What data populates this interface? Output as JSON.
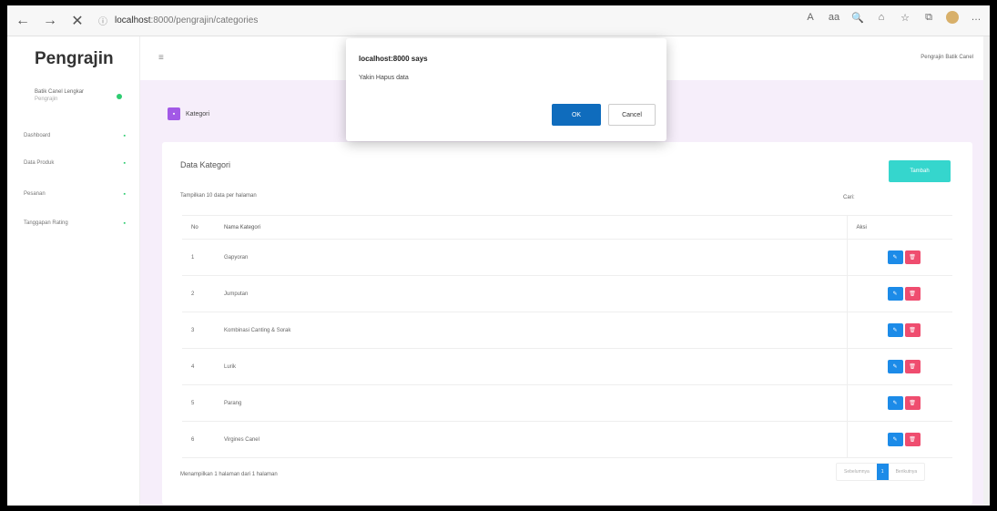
{
  "browser": {
    "url_host": "localhost",
    "url_path": ":8000/pengrajin/categories",
    "back_icon": "←",
    "forward_icon": "→",
    "close_icon": "✕",
    "info_icon": "ⓘ",
    "icons": [
      "A",
      "аа",
      "🔍",
      "⌂",
      "☆",
      "⧉",
      "●",
      "…"
    ]
  },
  "sidebar": {
    "brand": "Pengrajin",
    "user_name": "Batik Canel Lengkar",
    "user_sub": "Pengrajin",
    "items": [
      {
        "label": "Dashboard",
        "icon": "▪"
      },
      {
        "label": "Data Produk",
        "icon": "▪"
      },
      {
        "label": "Pesanan",
        "icon": "▪"
      },
      {
        "label": "Tanggapan Rating",
        "icon": "▪"
      }
    ]
  },
  "topbar": {
    "menu_icon": "≡",
    "user_label": "Pengrajin Batik Canel"
  },
  "page": {
    "icon": "▪",
    "title": "Kategori"
  },
  "card": {
    "title": "Data Kategori",
    "add_label": "Tambah",
    "length_label": "Tampilkan  10  data per halaman",
    "search_label": "Cari:",
    "columns": [
      "No",
      "Nama Kategori",
      "Aksi"
    ],
    "rows": [
      {
        "no": "1",
        "name": "Gapyoran"
      },
      {
        "no": "2",
        "name": "Jumputan"
      },
      {
        "no": "3",
        "name": "Kombinasi Canting & Sorak"
      },
      {
        "no": "4",
        "name": "Lurik"
      },
      {
        "no": "5",
        "name": "Parang"
      },
      {
        "no": "6",
        "name": "Virgines Canel"
      }
    ],
    "edit_icon": "✎",
    "delete_icon": "🗑",
    "info": "Menampilkan 1 halaman dari 1 halaman",
    "pager": {
      "prev": "Sebelumnya",
      "current": "1",
      "next": "Berikutnya"
    }
  },
  "dialog": {
    "title": "localhost:8000 says",
    "message": "Yakin Hapus data",
    "ok_label": "OK",
    "cancel_label": "Cancel"
  }
}
